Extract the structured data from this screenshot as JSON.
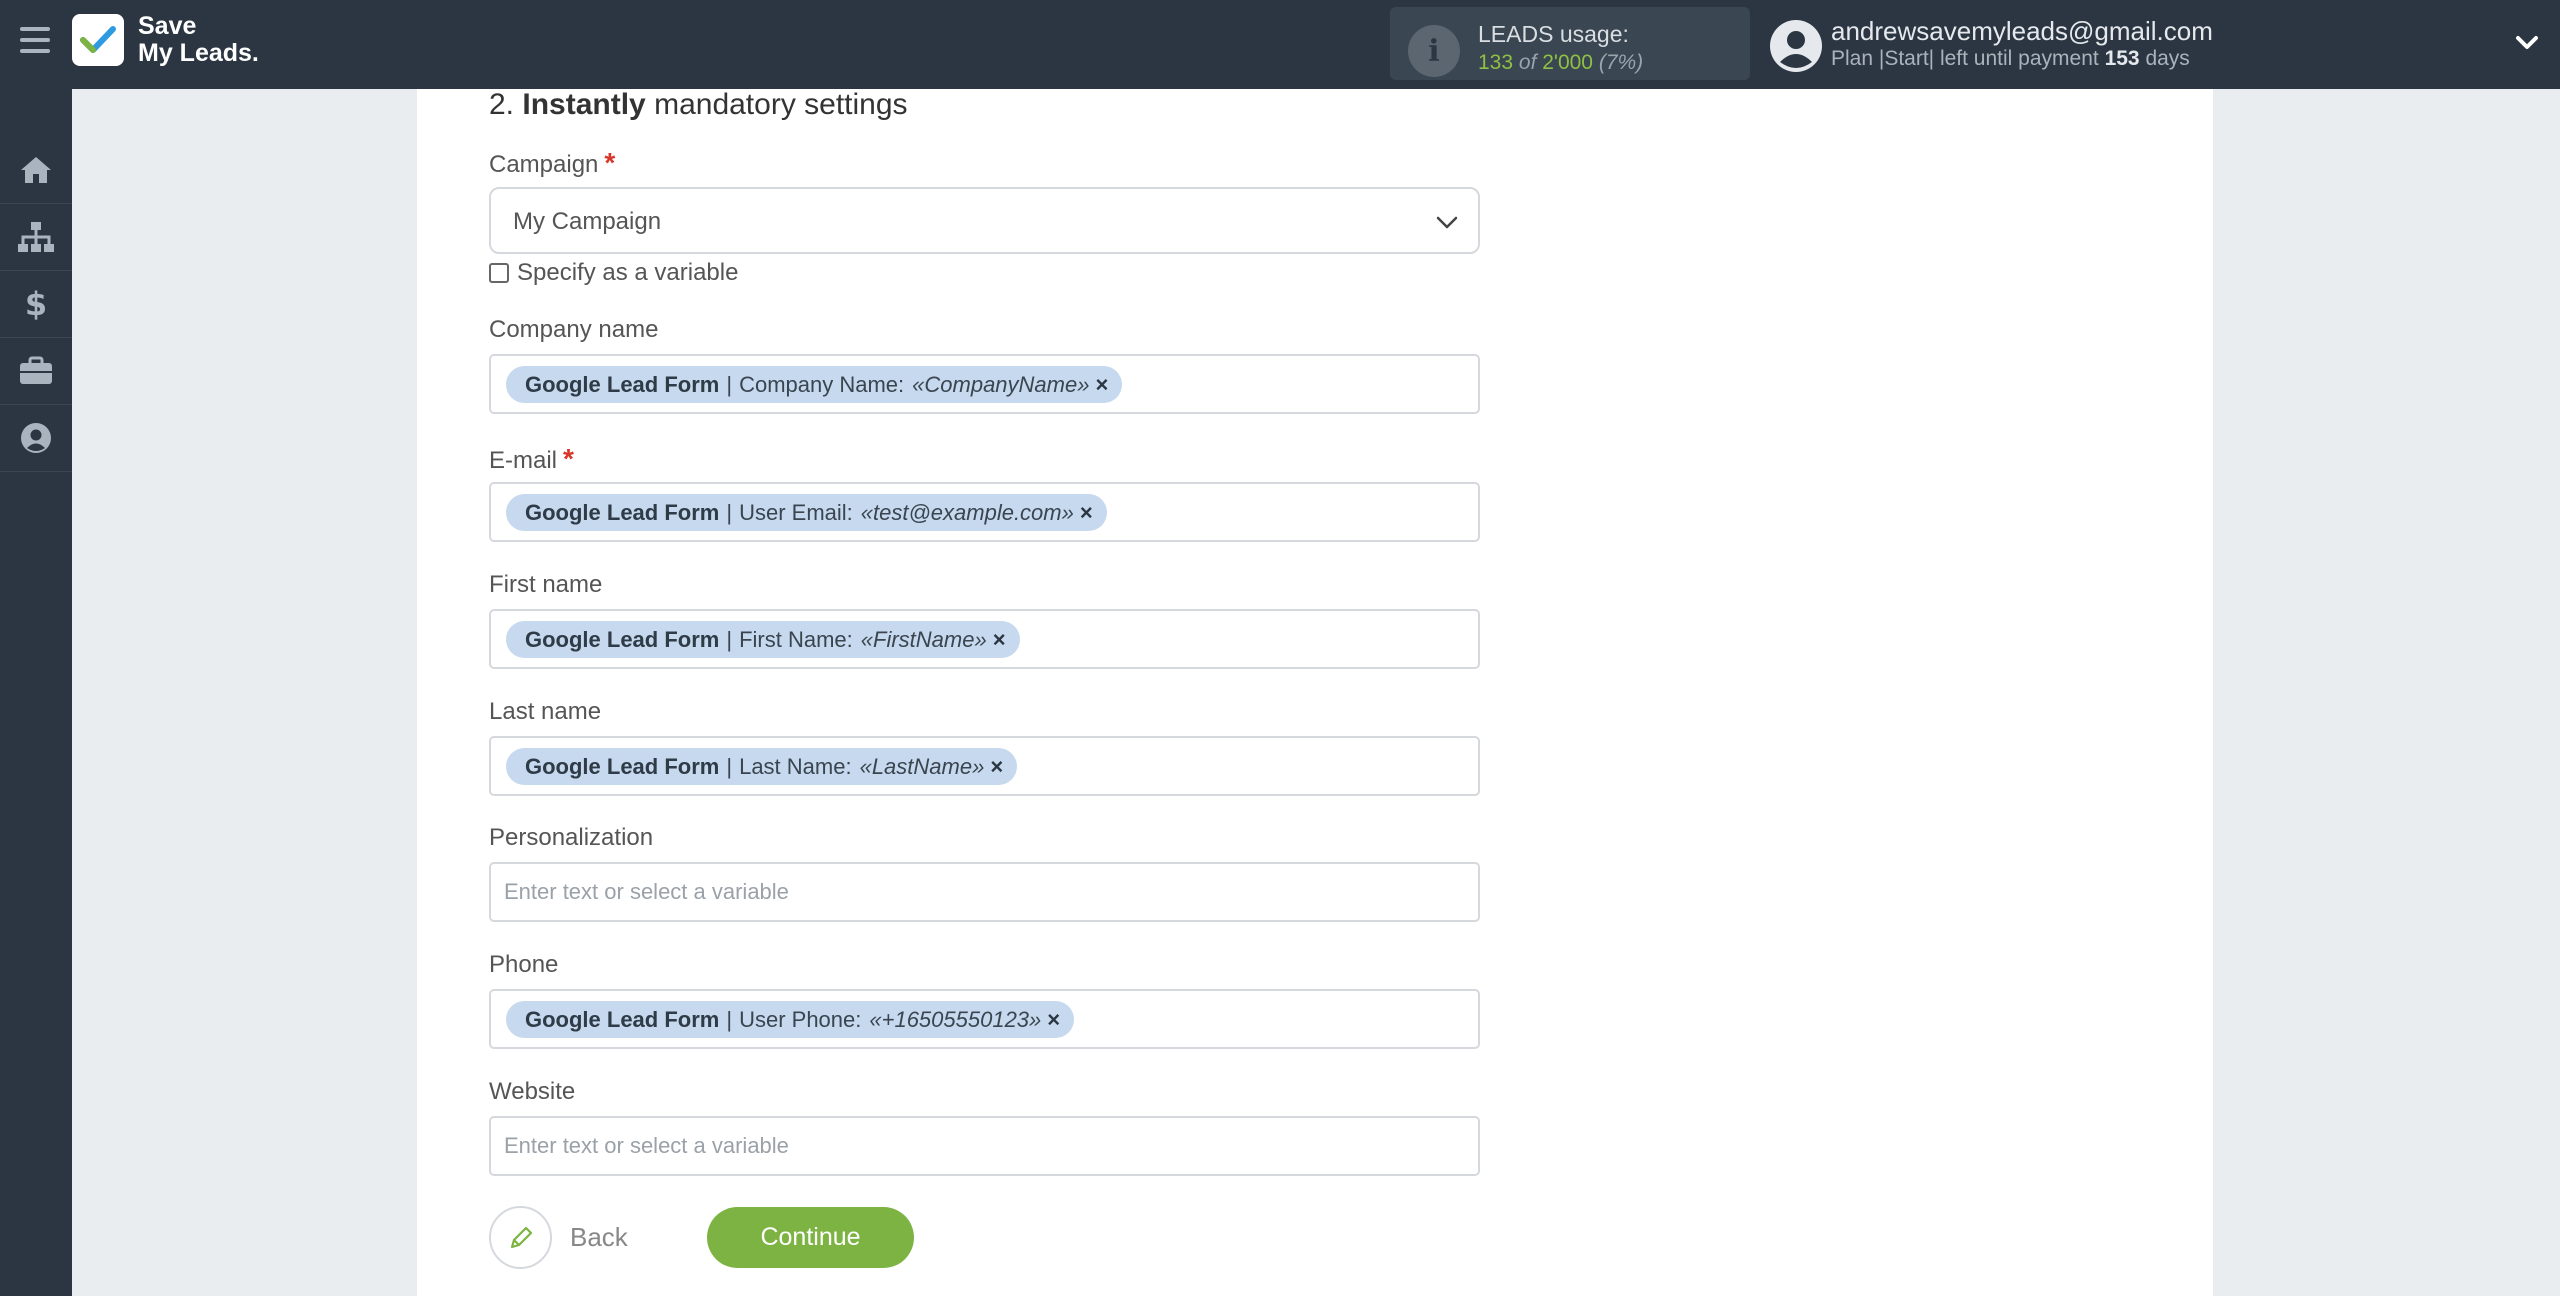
{
  "header": {
    "logo_line1": "Save",
    "logo_line2": "My Leads.",
    "usage_title": "LEADS usage:",
    "usage_used": "133",
    "usage_of": "of",
    "usage_total": "2'000",
    "usage_percent": "(7%)",
    "account_email": "andrewsavemyleads@gmail.com",
    "plan_prefix": "Plan |Start| left until payment",
    "plan_days": "153",
    "plan_suffix": "days"
  },
  "sidebar": {
    "items": [
      {
        "icon": "home-icon"
      },
      {
        "icon": "sitemap-icon"
      },
      {
        "icon": "dollar-icon"
      },
      {
        "icon": "briefcase-icon"
      },
      {
        "icon": "user-circle-icon"
      }
    ]
  },
  "section": {
    "number": "2.",
    "title_bold": "Instantly",
    "title_rest": "mandatory settings"
  },
  "form": {
    "campaign_label": "Campaign",
    "required_mark": "*",
    "campaign_value": "My Campaign",
    "specify_variable_label": "Specify as a variable",
    "company_label": "Company name",
    "company_tag": {
      "source": "Google Lead Form",
      "sep": "|",
      "field": "Company Name:",
      "value": "«CompanyName»",
      "remove": "×"
    },
    "email_label": "E-mail",
    "email_tag": {
      "source": "Google Lead Form",
      "sep": "|",
      "field": "User Email:",
      "value": "«test@example.com»",
      "remove": "×"
    },
    "first_name_label": "First name",
    "first_name_tag": {
      "source": "Google Lead Form",
      "sep": "|",
      "field": "First Name:",
      "value": "«FirstName»",
      "remove": "×"
    },
    "last_name_label": "Last name",
    "last_name_tag": {
      "source": "Google Lead Form",
      "sep": "|",
      "field": "Last Name:",
      "value": "«LastName»",
      "remove": "×"
    },
    "personalization_label": "Personalization",
    "personalization_placeholder": "Enter text or select a variable",
    "phone_label": "Phone",
    "phone_tag": {
      "source": "Google Lead Form",
      "sep": "|",
      "field": "User Phone:",
      "value": "«+16505550123»",
      "remove": "×"
    },
    "website_label": "Website",
    "website_placeholder": "Enter text or select a variable"
  },
  "actions": {
    "back_label": "Back",
    "continue_label": "Continue"
  },
  "colors": {
    "topbar": "#2b3642",
    "accent_green": "#7cb342",
    "tag_bg": "#c6d9ee",
    "required": "#d9362b"
  }
}
